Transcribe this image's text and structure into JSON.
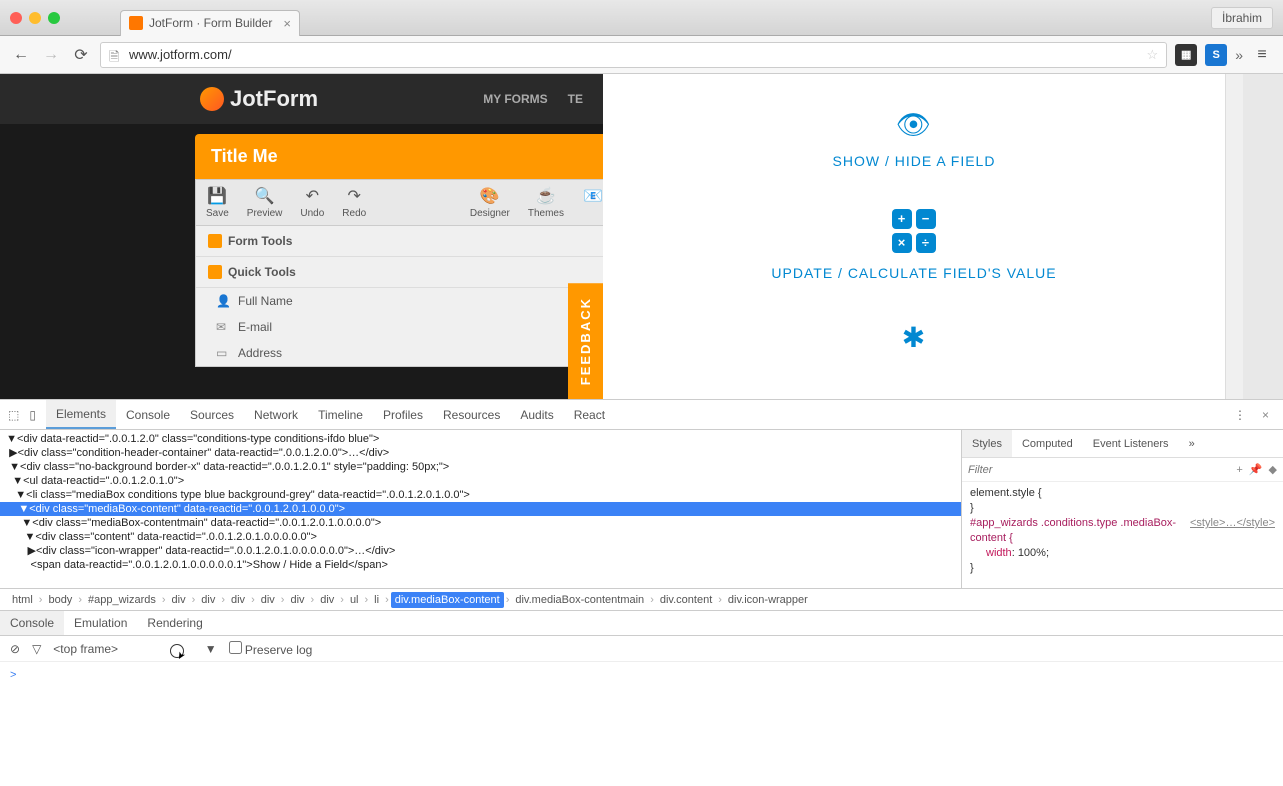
{
  "browser": {
    "tab_title": "JotForm · Form Builder",
    "profile": "İbrahim",
    "url": "www.jotform.com/",
    "ext2_label": "S"
  },
  "page": {
    "logo": "JotForm",
    "nav_myforms": "MY FORMS",
    "nav_te": "TE",
    "title": "Title Me",
    "toolbar": {
      "save": "Save",
      "preview": "Preview",
      "undo": "Undo",
      "redo": "Redo",
      "designer": "Designer",
      "themes": "Themes"
    },
    "section1": "Form Tools",
    "section2": "Quick Tools",
    "items": {
      "fullname": "Full Name",
      "email": "E-mail",
      "address": "Address"
    },
    "feedback": "FEEDBACK",
    "cond1": "SHOW / HIDE A FIELD",
    "cond2": "UPDATE / CALCULATE FIELD'S VALUE"
  },
  "devtools": {
    "tabs": {
      "elements": "Elements",
      "console": "Console",
      "sources": "Sources",
      "network": "Network",
      "timeline": "Timeline",
      "profiles": "Profiles",
      "resources": "Resources",
      "audits": "Audits",
      "react": "React"
    },
    "styles_tabs": {
      "styles": "Styles",
      "computed": "Computed",
      "listeners": "Event Listeners"
    },
    "filter_placeholder": "Filter",
    "element_style": "element.style {",
    "brace_close": "}",
    "rule_sel": "#app_wizards .conditions.type .mediaBox-content {",
    "rule_src": "<style>…</style>",
    "rule_prop": "width",
    "rule_val": "100%;",
    "breadcrumb": {
      "html": "html",
      "body": "body",
      "app": "#app_wizards",
      "div": "div",
      "ul": "ul",
      "li": "li",
      "active": "div.mediaBox-content",
      "contentmain": "div.mediaBox-contentmain",
      "content": "div.content",
      "iconwrap": "div.icon-wrapper"
    },
    "drawer": {
      "console": "Console",
      "emulation": "Emulation",
      "rendering": "Rendering"
    },
    "console": {
      "frame": "<top frame>",
      "preserve": "Preserve log",
      "prompt": ">"
    },
    "dom": {
      "l1": "  ▼<div data-reactid=\".0.0.1.2.0\" class=\"conditions-type conditions-ifdo blue\">",
      "l2": "   ▶<div class=\"condition-header-container\" data-reactid=\".0.0.1.2.0.0\">…</div>",
      "l3": "   ▼<div class=\"no-background border-x\" data-reactid=\".0.0.1.2.0.1\" style=\"padding: 50px;\">",
      "l4": "    ▼<ul data-reactid=\".0.0.1.2.0.1.0\">",
      "l5": "     ▼<li class=\"mediaBox conditions type blue background-grey\" data-reactid=\".0.0.1.2.0.1.0.0\">",
      "l6": "      ▼<div class=\"mediaBox-content\" data-reactid=\".0.0.1.2.0.1.0.0.0\">",
      "l7": "       ▼<div class=\"mediaBox-contentmain\" data-reactid=\".0.0.1.2.0.1.0.0.0.0\">",
      "l8": "        ▼<div class=\"content\" data-reactid=\".0.0.1.2.0.1.0.0.0.0.0\">",
      "l9": "         ▶<div class=\"icon-wrapper\" data-reactid=\".0.0.1.2.0.1.0.0.0.0.0.0\">…</div>",
      "l10": "          <span data-reactid=\".0.0.1.2.0.1.0.0.0.0.0.1\">Show / Hide a Field</span>"
    }
  }
}
